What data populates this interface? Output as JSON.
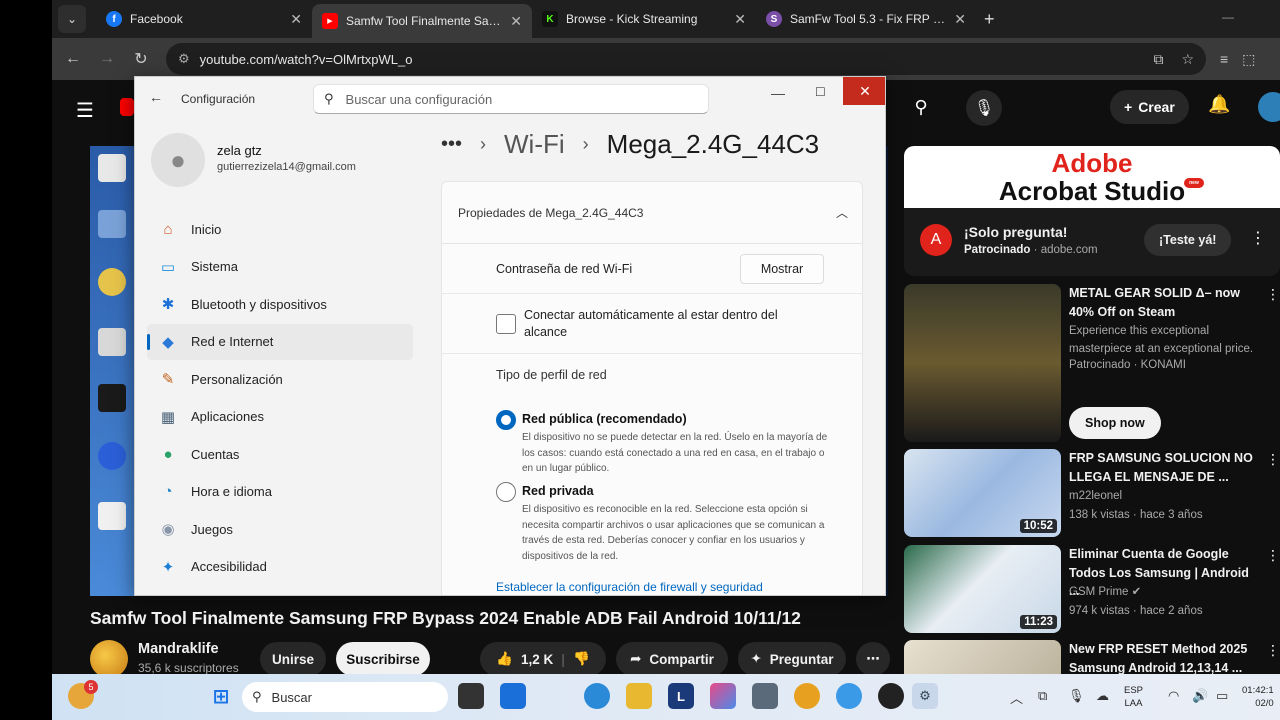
{
  "browser": {
    "tabs": [
      {
        "title": "Facebook",
        "favicon": "facebook-icon",
        "color": "#1877f2",
        "letter": "f"
      },
      {
        "title": "Samfw Tool Finalmente Samsung",
        "favicon": "youtube-icon",
        "color": "#ff0000",
        "letter": "▶"
      },
      {
        "title": "Browse - Kick Streaming",
        "favicon": "kick-icon",
        "color": "#53fc18",
        "letter": "K"
      },
      {
        "title": "SamFw Tool 5.3 - Fix FRP 2022,",
        "favicon": "samfw-icon",
        "color": "#7a4fa8",
        "letter": "S"
      }
    ],
    "url": "youtube.com/watch?v=OlMrtxpWL_o",
    "close_glyph": "✕",
    "new_tab_glyph": "+"
  },
  "youtube": {
    "create_label": "Crear",
    "video_title": "Samfw Tool Finalmente Samsung FRP Bypass 2024 Enable ADB Fail Android 10/11/12",
    "channel_name": "Mandraklife",
    "channel_subs": "35,6 k suscriptores",
    "join_label": "Unirse",
    "subscribe_label": "Suscribirse",
    "likes": "1,2 K",
    "share_label": "Compartir",
    "ask_label": "Preguntar",
    "ad": {
      "brand_line1": "Adobe",
      "brand_line2": "Acrobat Studio",
      "badge": "new",
      "title": "¡Solo pregunta!",
      "sponsored": "Patrocinado",
      "domain": "· adobe.com",
      "cta": "¡Teste yá!"
    },
    "recommended": [
      {
        "title": "METAL GEAR SOLID Δ– now 40% Off on Steam",
        "line2": "Experience this exceptional masterpiece at an exceptional price.",
        "line3": "Patrocinado · KONAMI",
        "cta": "Shop now",
        "duration": ""
      },
      {
        "title": "FRP SAMSUNG SOLUCION NO LLEGA EL MENSAJE DE ...",
        "line2": "m22leonel",
        "line3": "138 k vistas · hace 3 años",
        "duration": "10:52"
      },
      {
        "title": "Eliminar Cuenta de Google Todos Los Samsung | Android ...",
        "line2": "GSM Prime ✔",
        "line3": "974 k vistas · hace 2 años",
        "duration": "11:23"
      },
      {
        "title": "New FRP RESET Method 2025 Samsung Android 12,13,14 ...",
        "line2": "",
        "line3": "",
        "duration": ""
      }
    ]
  },
  "settings": {
    "app_title": "Configuración",
    "search_placeholder": "Buscar una configuración",
    "user_name": "zela gtz",
    "user_email": "gutierrezizela14@gmail.com",
    "nav": [
      {
        "label": "Inicio",
        "icon": "home-icon",
        "glyph": "⌂",
        "color": "#d35a2a"
      },
      {
        "label": "Sistema",
        "icon": "system-icon",
        "glyph": "▭",
        "color": "#1b8fd8"
      },
      {
        "label": "Bluetooth y dispositivos",
        "icon": "bluetooth-icon",
        "glyph": "✱",
        "color": "#1b6fd8"
      },
      {
        "label": "Red e Internet",
        "icon": "wifi-icon",
        "glyph": "◆",
        "color": "#2b7ad8"
      },
      {
        "label": "Personalización",
        "icon": "brush-icon",
        "glyph": "✎",
        "color": "#c2601a"
      },
      {
        "label": "Aplicaciones",
        "icon": "apps-icon",
        "glyph": "▦",
        "color": "#4a6278"
      },
      {
        "label": "Cuentas",
        "icon": "accounts-icon",
        "glyph": "●",
        "color": "#2aa36a"
      },
      {
        "label": "Hora e idioma",
        "icon": "globe-clock-icon",
        "glyph": "◔",
        "color": "#2b86c8"
      },
      {
        "label": "Juegos",
        "icon": "gamepad-icon",
        "glyph": "◉",
        "color": "#8796a8"
      },
      {
        "label": "Accesibilidad",
        "icon": "accessibility-icon",
        "glyph": "✦",
        "color": "#1b7fd8"
      }
    ],
    "active_nav": "Red e Internet",
    "breadcrumb": [
      "Wi-Fi",
      "Mega_2.4G_44C3"
    ],
    "panel_title": "Propiedades de Mega_2.4G_44C3",
    "password_label": "Contraseña de red Wi-Fi",
    "show_button": "Mostrar",
    "auto_connect_label": "Conectar automáticamente al estar dentro del alcance",
    "profile_type_label": "Tipo de perfil de red",
    "public_title": "Red pública (recomendado)",
    "public_desc": "El dispositivo no se puede detectar en la red. Úselo en la mayoría de los casos: cuando está conectado a una red en casa, en el trabajo o en un lugar público.",
    "private_title": "Red privada",
    "private_desc": "El dispositivo es reconocible en la red. Seleccione esta opción si necesita compartir archivos o usar aplicaciones que se comunican a través de esta red. Deberías conocer y confiar en los usuarios y dispositivos de la red.",
    "firewall_link": "Establecer la configuración de firewall y seguridad"
  },
  "taskbar": {
    "search_placeholder": "Buscar",
    "lang_line1": "ESP",
    "lang_line2": "LAA",
    "time": "01:42:1",
    "date": "02/0",
    "notification_count": "5"
  }
}
